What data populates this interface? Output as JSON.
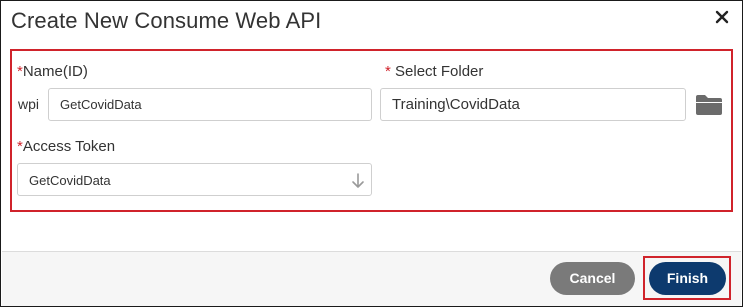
{
  "dialog": {
    "title": "Create New Consume Web API",
    "close_icon": "close-icon"
  },
  "form": {
    "name": {
      "required_mark": "*",
      "label": "Name(ID)",
      "prefix": "wpi",
      "value": "GetCovidData"
    },
    "folder": {
      "required_mark": "*",
      "label": " Select Folder",
      "value": "Training\\CovidData",
      "browse_icon": "folder-icon"
    },
    "access_token": {
      "required_mark": "*",
      "label": "Access Token",
      "selected": "GetCovidData",
      "arrow_icon": "arrow-down-icon"
    }
  },
  "footer": {
    "cancel_label": "Cancel",
    "finish_label": "Finish"
  },
  "colors": {
    "highlight": "#d0232b",
    "finish_bg": "#0d3a6e",
    "cancel_bg": "#7a7a7a"
  }
}
